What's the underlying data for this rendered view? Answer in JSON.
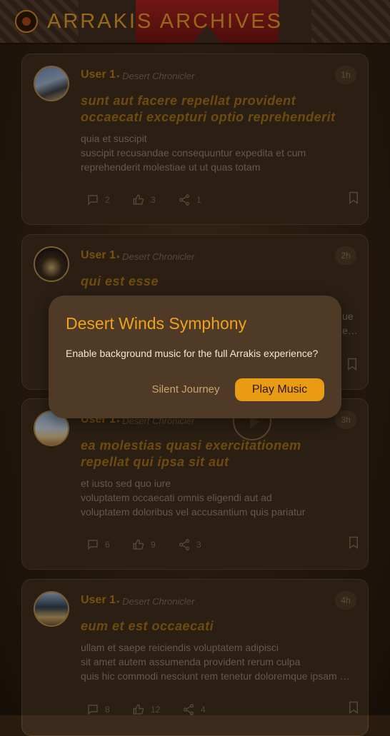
{
  "app": {
    "title": "ARRAKIS ARCHIVES"
  },
  "posts": [
    {
      "user": "User 1",
      "role": "• Desert Chronicler",
      "time": "1h",
      "title": "sunt aut facere repellat provident occaecati excepturi optio reprehenderit",
      "body": "quia et suscipit\nsuscipit recusandae consequuntur expedita et cum\nreprehenderit molestiae ut ut quas totam",
      "comments": "2",
      "likes": "3",
      "shares": "1"
    },
    {
      "user": "User 1",
      "role": "• Desert Chronicler",
      "time": "2h",
      "title": "qui est esse",
      "body_right": "ue\ne…"
    },
    {
      "user": "User 1",
      "role": "• Desert Chronicler",
      "time": "3h",
      "title": "ea molestias quasi exercitationem repellat qui ipsa sit aut",
      "body": "et iusto sed quo iure\nvoluptatem occaecati omnis eligendi aut ad\nvoluptatem doloribus vel accusantium quis pariatur",
      "comments": "6",
      "likes": "9",
      "shares": "3"
    },
    {
      "user": "User 1",
      "role": "• Desert Chronicler",
      "time": "4h",
      "title": "eum et est occaecati",
      "body": "ullam et saepe reiciendis voluptatem adipisci\nsit amet autem assumenda provident rerum culpa\nquis hic commodi nesciunt rem tenetur doloremque ipsam …",
      "comments": "8",
      "likes": "12",
      "shares": "4"
    }
  ],
  "dialog": {
    "title": "Desert Winds Symphony",
    "message": "Enable background music for the full Arrakis experience?",
    "secondary": "Silent Journey",
    "primary": "Play Music"
  },
  "icons": {
    "comment": "comment-icon",
    "like": "thumbs-up-icon",
    "share": "share-icon",
    "bookmark": "bookmark-icon"
  },
  "colors": {
    "accent": "#e99b14",
    "title": "#e39d24",
    "banner": "#a81f1f"
  }
}
